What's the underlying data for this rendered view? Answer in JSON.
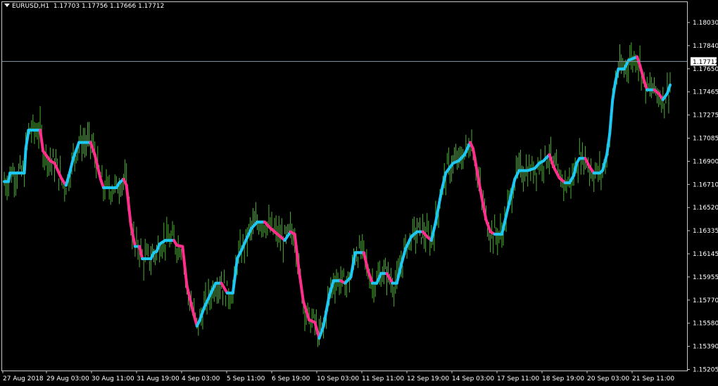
{
  "chart_title": {
    "symbol": "EURUSD,H1",
    "ohlc": "1.17703 1.17756 1.17666 1.17712"
  },
  "colors": {
    "background": "#000000",
    "bars": "#4caf35",
    "trend_up": "#1ec8f5",
    "trend_down": "#ff2d8c",
    "axis_text": "#ffffff",
    "price_line": "#8a9aa6"
  },
  "chart_data": {
    "type": "line",
    "title": "",
    "current_price_label": "1.17712",
    "current_price": 1.17712,
    "y_ticks": [
      "1.18030",
      "1.17840",
      "1.17650",
      "1.17465",
      "1.17275",
      "1.17085",
      "1.16900",
      "1.16710",
      "1.16520",
      "1.16335",
      "1.16145",
      "1.15955",
      "1.15770",
      "1.15580",
      "1.15390",
      "1.15205"
    ],
    "ylim": [
      1.152,
      1.1813
    ],
    "x_ticks": [
      "27 Aug 2018",
      "29 Aug 03:00",
      "30 Aug 11:00",
      "31 Aug 19:00",
      "4 Sep 03:00",
      "5 Sep 11:00",
      "6 Sep 19:00",
      "10 Sep 03:00",
      "11 Sep 11:00",
      "12 Sep 19:00",
      "14 Sep 03:00",
      "17 Sep 11:00",
      "18 Sep 19:00",
      "20 Sep 03:00",
      "21 Sep 11:00"
    ],
    "trend_line": [
      {
        "i": 0,
        "v": 1.1673
      },
      {
        "i": 3,
        "v": 1.1673
      },
      {
        "i": 4,
        "v": 1.168
      },
      {
        "i": 14,
        "v": 1.168
      },
      {
        "i": 15,
        "v": 1.17
      },
      {
        "i": 17,
        "v": 1.1715
      },
      {
        "i": 25,
        "v": 1.1715
      },
      {
        "i": 27,
        "v": 1.1698
      },
      {
        "i": 32,
        "v": 1.169
      },
      {
        "i": 35,
        "v": 1.1688
      },
      {
        "i": 40,
        "v": 1.1675
      },
      {
        "i": 43,
        "v": 1.167
      },
      {
        "i": 45,
        "v": 1.1678
      },
      {
        "i": 48,
        "v": 1.1692
      },
      {
        "i": 52,
        "v": 1.1705
      },
      {
        "i": 60,
        "v": 1.1705
      },
      {
        "i": 63,
        "v": 1.1695
      },
      {
        "i": 67,
        "v": 1.1675
      },
      {
        "i": 69,
        "v": 1.1668
      },
      {
        "i": 78,
        "v": 1.1668
      },
      {
        "i": 80,
        "v": 1.1672
      },
      {
        "i": 83,
        "v": 1.1675
      },
      {
        "i": 85,
        "v": 1.167
      },
      {
        "i": 88,
        "v": 1.1638
      },
      {
        "i": 91,
        "v": 1.162
      },
      {
        "i": 94,
        "v": 1.162
      },
      {
        "i": 96,
        "v": 1.161
      },
      {
        "i": 102,
        "v": 1.161
      },
      {
        "i": 104,
        "v": 1.1615
      },
      {
        "i": 106,
        "v": 1.1616
      },
      {
        "i": 108,
        "v": 1.1622
      },
      {
        "i": 112,
        "v": 1.1625
      },
      {
        "i": 118,
        "v": 1.1625
      },
      {
        "i": 120,
        "v": 1.1621
      },
      {
        "i": 124,
        "v": 1.162
      },
      {
        "i": 127,
        "v": 1.1588
      },
      {
        "i": 131,
        "v": 1.1568
      },
      {
        "i": 134,
        "v": 1.1555
      },
      {
        "i": 136,
        "v": 1.156
      },
      {
        "i": 139,
        "v": 1.157
      },
      {
        "i": 143,
        "v": 1.158
      },
      {
        "i": 147,
        "v": 1.159
      },
      {
        "i": 151,
        "v": 1.159
      },
      {
        "i": 155,
        "v": 1.1582
      },
      {
        "i": 159,
        "v": 1.1582
      },
      {
        "i": 162,
        "v": 1.161
      },
      {
        "i": 165,
        "v": 1.1617
      },
      {
        "i": 168,
        "v": 1.1625
      },
      {
        "i": 172,
        "v": 1.1635
      },
      {
        "i": 176,
        "v": 1.164
      },
      {
        "i": 181,
        "v": 1.164
      },
      {
        "i": 185,
        "v": 1.1635
      },
      {
        "i": 190,
        "v": 1.163
      },
      {
        "i": 195,
        "v": 1.1625
      },
      {
        "i": 199,
        "v": 1.1632
      },
      {
        "i": 202,
        "v": 1.163
      },
      {
        "i": 205,
        "v": 1.16
      },
      {
        "i": 208,
        "v": 1.1575
      },
      {
        "i": 212,
        "v": 1.156
      },
      {
        "i": 216,
        "v": 1.1558
      },
      {
        "i": 219,
        "v": 1.1545
      },
      {
        "i": 222,
        "v": 1.1555
      },
      {
        "i": 226,
        "v": 1.158
      },
      {
        "i": 229,
        "v": 1.1592
      },
      {
        "i": 234,
        "v": 1.1592
      },
      {
        "i": 237,
        "v": 1.159
      },
      {
        "i": 241,
        "v": 1.1595
      },
      {
        "i": 244,
        "v": 1.1615
      },
      {
        "i": 250,
        "v": 1.1615
      },
      {
        "i": 253,
        "v": 1.16
      },
      {
        "i": 256,
        "v": 1.159
      },
      {
        "i": 259,
        "v": 1.159
      },
      {
        "i": 262,
        "v": 1.1598
      },
      {
        "i": 266,
        "v": 1.1598
      },
      {
        "i": 270,
        "v": 1.159
      },
      {
        "i": 273,
        "v": 1.159
      },
      {
        "i": 276,
        "v": 1.1605
      },
      {
        "i": 279,
        "v": 1.1618
      },
      {
        "i": 283,
        "v": 1.1628
      },
      {
        "i": 287,
        "v": 1.1632
      },
      {
        "i": 291,
        "v": 1.1632
      },
      {
        "i": 294,
        "v": 1.1628
      },
      {
        "i": 297,
        "v": 1.1625
      },
      {
        "i": 300,
        "v": 1.164
      },
      {
        "i": 304,
        "v": 1.1665
      },
      {
        "i": 307,
        "v": 1.168
      },
      {
        "i": 312,
        "v": 1.1688
      },
      {
        "i": 316,
        "v": 1.169
      },
      {
        "i": 320,
        "v": 1.1695
      },
      {
        "i": 324,
        "v": 1.1705
      },
      {
        "i": 326,
        "v": 1.17
      },
      {
        "i": 329,
        "v": 1.168
      },
      {
        "i": 332,
        "v": 1.166
      },
      {
        "i": 335,
        "v": 1.1642
      },
      {
        "i": 338,
        "v": 1.1632
      },
      {
        "i": 341,
        "v": 1.163
      },
      {
        "i": 346,
        "v": 1.163
      },
      {
        "i": 349,
        "v": 1.1645
      },
      {
        "i": 352,
        "v": 1.166
      },
      {
        "i": 355,
        "v": 1.1675
      },
      {
        "i": 358,
        "v": 1.1682
      },
      {
        "i": 364,
        "v": 1.1682
      },
      {
        "i": 369,
        "v": 1.1684
      },
      {
        "i": 372,
        "v": 1.1688
      },
      {
        "i": 375,
        "v": 1.169
      },
      {
        "i": 379,
        "v": 1.1695
      },
      {
        "i": 382,
        "v": 1.1685
      },
      {
        "i": 386,
        "v": 1.1676
      },
      {
        "i": 390,
        "v": 1.1672
      },
      {
        "i": 393,
        "v": 1.1672
      },
      {
        "i": 396,
        "v": 1.1678
      },
      {
        "i": 398,
        "v": 1.1688
      },
      {
        "i": 400,
        "v": 1.1692
      },
      {
        "i": 404,
        "v": 1.1692
      },
      {
        "i": 407,
        "v": 1.1685
      },
      {
        "i": 410,
        "v": 1.168
      },
      {
        "i": 414,
        "v": 1.168
      },
      {
        "i": 416,
        "v": 1.1682
      },
      {
        "i": 419,
        "v": 1.1695
      },
      {
        "i": 421,
        "v": 1.1712
      },
      {
        "i": 423,
        "v": 1.174
      },
      {
        "i": 425,
        "v": 1.1755
      },
      {
        "i": 427,
        "v": 1.1765
      },
      {
        "i": 431,
        "v": 1.1765
      },
      {
        "i": 434,
        "v": 1.1772
      },
      {
        "i": 440,
        "v": 1.1775
      },
      {
        "i": 442,
        "v": 1.1768
      },
      {
        "i": 445,
        "v": 1.1755
      },
      {
        "i": 447,
        "v": 1.1748
      },
      {
        "i": 452,
        "v": 1.1748
      },
      {
        "i": 455,
        "v": 1.1745
      },
      {
        "i": 458,
        "v": 1.174
      },
      {
        "i": 461,
        "v": 1.1745
      },
      {
        "i": 463,
        "v": 1.1752
      }
    ],
    "n_bars": 464,
    "grid": false
  }
}
